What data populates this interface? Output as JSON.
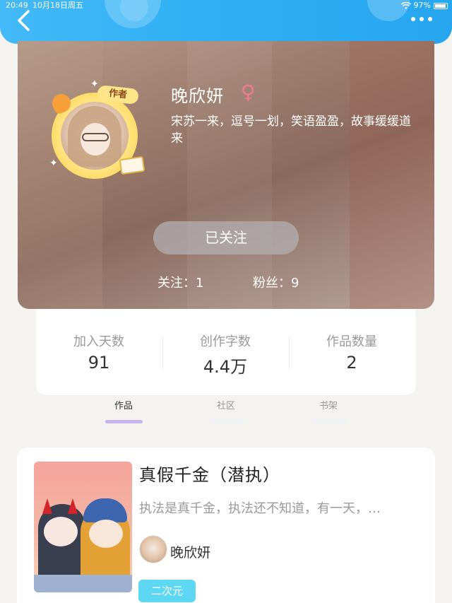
{
  "status_bar": {
    "time": "20:49",
    "date": "10月18日周五",
    "battery": "97%"
  },
  "profile": {
    "name": "晚欣妍",
    "gender_symbol": "♀",
    "author_badge": "作者",
    "bio": "宋苏一来，逗号一划，笑语盈盈，故事缓缓道来",
    "follow_button": "已关注",
    "following": "关注：1",
    "fans": "粉丝：9"
  },
  "stats": [
    {
      "label": "加入天数",
      "value": "91"
    },
    {
      "label": "创作字数",
      "value": "4.4万"
    },
    {
      "label": "作品数量",
      "value": "2"
    }
  ],
  "tabs": [
    {
      "label": "作品",
      "active": true
    },
    {
      "label": "社区",
      "active": false
    },
    {
      "label": "书架",
      "active": false
    }
  ],
  "work": {
    "title": "真假千金（潜执）",
    "description": "执法是真千金，执法还不知道，有一天，…",
    "author": "晚欣妍",
    "tag": "二次元"
  },
  "colors": {
    "topbar": "#2fb0f5",
    "gender": "#ee7b8d",
    "active_tab_bar": "#c8b4ea",
    "inactive_tab_bar": "#eef2f6",
    "tag": "#5ed8f2"
  }
}
